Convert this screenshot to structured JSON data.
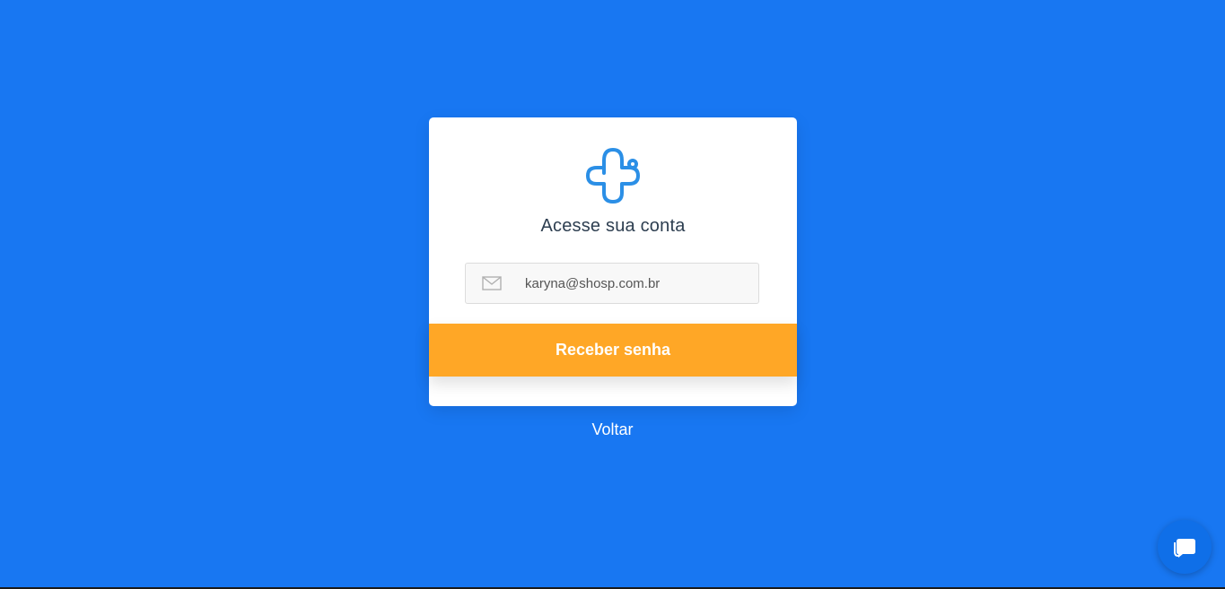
{
  "login": {
    "logo_icon": "stethoscope-cross-icon",
    "title": "Acesse sua conta",
    "email_icon": "mail-icon",
    "email_value": "karyna@shosp.com.br",
    "submit_label": "Receber senha",
    "back_label": "Voltar"
  },
  "chat": {
    "icon": "chat-bubble-icon"
  },
  "colors": {
    "background": "#1877f2",
    "accent_button": "#ffa726",
    "logo": "#2b8fe6"
  }
}
